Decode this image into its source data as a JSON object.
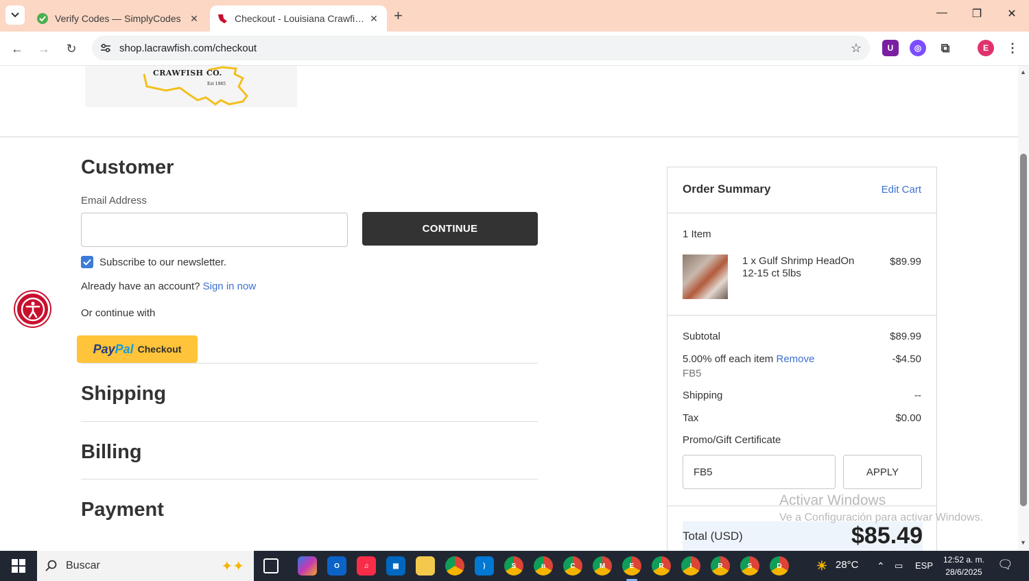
{
  "browser": {
    "tabs": [
      {
        "title": "Verify Codes — SimplyCodes",
        "active": false
      },
      {
        "title": "Checkout - Louisiana Crawfish Co",
        "active": true
      }
    ],
    "url": "shop.lacrawfish.com/checkout",
    "profile_initial": "E"
  },
  "header": {
    "logo_name": "CRAWFISH CO.",
    "logo_est": "Est 1985"
  },
  "customer": {
    "heading": "Customer",
    "email_label": "Email Address",
    "email_value": "",
    "continue_label": "CONTINUE",
    "newsletter_label": "Subscribe to our newsletter.",
    "newsletter_checked": true,
    "account_prompt": "Already have an account?",
    "sign_in_label": "Sign in now",
    "or_continue": "Or continue with",
    "paypal_brand_1": "Pay",
    "paypal_brand_2": "Pal",
    "paypal_checkout": "Checkout"
  },
  "sections": {
    "shipping": "Shipping",
    "billing": "Billing",
    "payment": "Payment"
  },
  "summary": {
    "title": "Order Summary",
    "edit_cart": "Edit Cart",
    "item_count": "1 Item",
    "item_name": "1 x Gulf Shrimp HeadOn 12-15 ct 5lbs",
    "item_price": "$89.99",
    "subtotal_label": "Subtotal",
    "subtotal_value": "$89.99",
    "discount_label": "5.00% off each item",
    "discount_remove": "Remove",
    "discount_code": "FB5",
    "discount_value": "-$4.50",
    "shipping_label": "Shipping",
    "shipping_value": "--",
    "tax_label": "Tax",
    "tax_value": "$0.00",
    "promo_label": "Promo/Gift Certificate",
    "promo_input_value": "FB5",
    "apply_label": "APPLY",
    "total_label": "Total (USD)",
    "total_value": "$85.49"
  },
  "watermark": {
    "line1": "Activar Windows",
    "line2": "Ve a Configuración para activar Windows."
  },
  "taskbar": {
    "search_label": "Buscar",
    "temperature": "28°C",
    "language": "ESP",
    "time": "12:52 a. m.",
    "date": "28/6/2025"
  },
  "colors": {
    "tab_strip": "#fbd7c4",
    "link": "#3d6fd1",
    "continue_bg": "#333333",
    "paypal_bg": "#ffc439"
  }
}
